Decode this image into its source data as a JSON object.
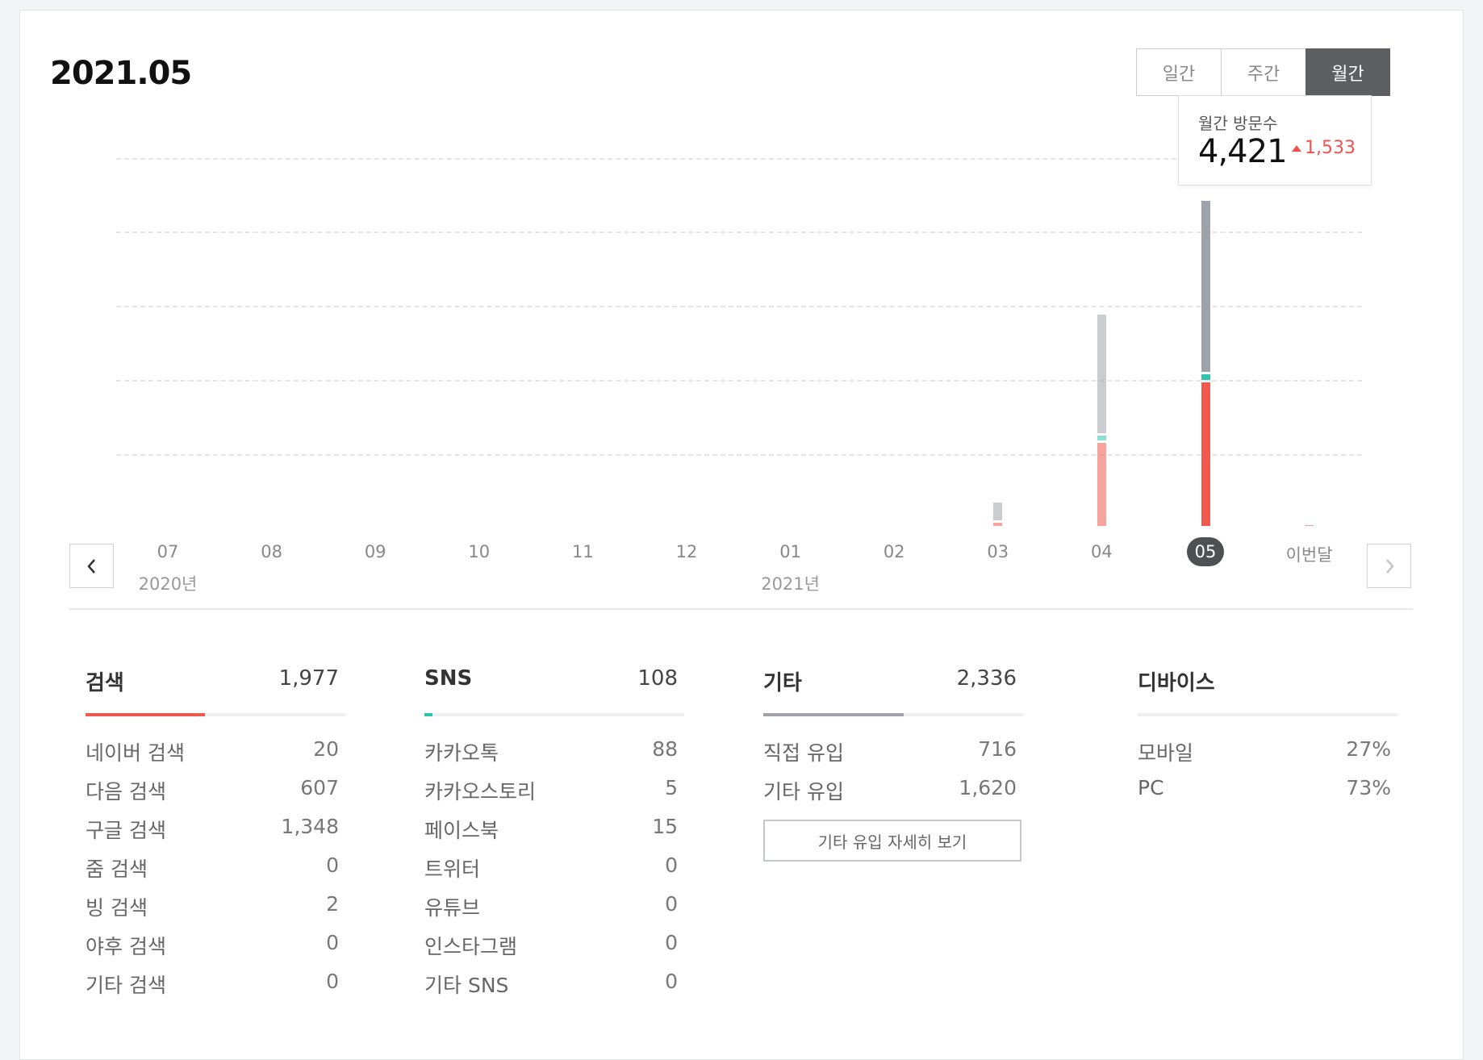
{
  "period": "2021.05",
  "toggle": [
    "일간",
    "주간",
    "월간"
  ],
  "tooltip": {
    "label": "월간 방문수",
    "value": "4,421",
    "delta": "1,533"
  },
  "chart_data": {
    "type": "bar",
    "categories": [
      "07",
      "08",
      "09",
      "10",
      "11",
      "12",
      "01",
      "02",
      "03",
      "04",
      "05",
      "이번달"
    ],
    "year_labels": [
      {
        "category": "07",
        "text": "2020년"
      },
      {
        "category": "01",
        "text": "2021년"
      }
    ],
    "selected": "05",
    "series": [
      {
        "name": "검색",
        "color": "#f05a4e",
        "values": [
          0,
          0,
          0,
          0,
          0,
          0,
          0,
          0,
          80,
          1150,
          1977,
          40
        ]
      },
      {
        "name": "SNS",
        "color": "#2ec4b0",
        "values": [
          0,
          0,
          0,
          0,
          0,
          0,
          0,
          0,
          0,
          108,
          108,
          0
        ]
      },
      {
        "name": "기타",
        "color": "#9ea3aa",
        "values": [
          0,
          0,
          0,
          0,
          0,
          0,
          0,
          0,
          270,
          1630,
          2336,
          30
        ]
      }
    ],
    "ylim": [
      0,
      5000
    ],
    "grid": true
  },
  "stats": [
    {
      "name": "검색",
      "total": "1,977",
      "fill_ratio": 0.46,
      "fill_color": "#f05a4e",
      "rows": [
        {
          "label": "네이버 검색",
          "value": "20"
        },
        {
          "label": "다음 검색",
          "value": "607"
        },
        {
          "label": "구글 검색",
          "value": "1,348"
        },
        {
          "label": "줌 검색",
          "value": "0"
        },
        {
          "label": "빙 검색",
          "value": "2"
        },
        {
          "label": "야후 검색",
          "value": "0"
        },
        {
          "label": "기타 검색",
          "value": "0"
        }
      ]
    },
    {
      "name": "SNS",
      "total": "108",
      "fill_ratio": 0.03,
      "fill_color": "#2ec4b0",
      "rows": [
        {
          "label": "카카오톡",
          "value": "88"
        },
        {
          "label": "카카오스토리",
          "value": "5"
        },
        {
          "label": "페이스북",
          "value": "15"
        },
        {
          "label": "트위터",
          "value": "0"
        },
        {
          "label": "유튜브",
          "value": "0"
        },
        {
          "label": "인스타그램",
          "value": "0"
        },
        {
          "label": "기타 SNS",
          "value": "0"
        }
      ]
    },
    {
      "name": "기타",
      "total": "2,336",
      "fill_ratio": 0.54,
      "fill_color": "#9ea3aa",
      "rows": [
        {
          "label": "직접 유입",
          "value": "716"
        },
        {
          "label": "기타 유입",
          "value": "1,620"
        }
      ],
      "detail_button": "기타 유입 자세히 보기"
    },
    {
      "name": "디바이스",
      "total": "",
      "fill_ratio": 0,
      "fill_color": "#9ea3aa",
      "rows": [
        {
          "label": "모바일",
          "value": "27%"
        },
        {
          "label": "PC",
          "value": "73%"
        }
      ]
    }
  ],
  "nav": {
    "prev_icon": "chevron-left-icon",
    "next_icon": "chevron-right-icon"
  }
}
